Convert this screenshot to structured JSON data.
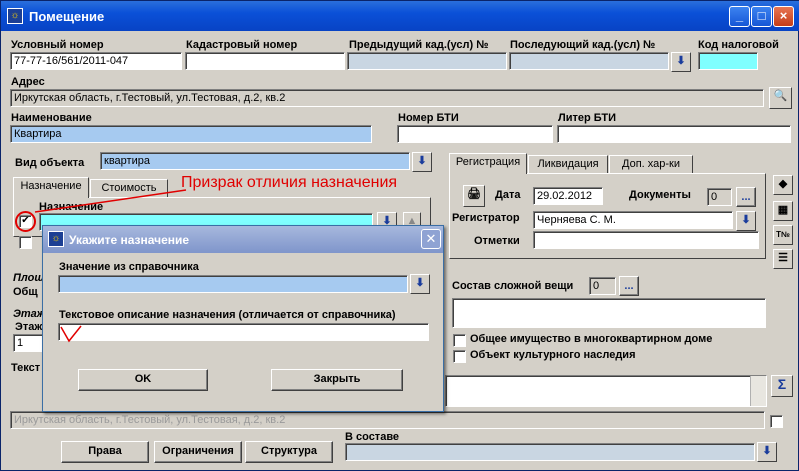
{
  "window": {
    "title": "Помещение",
    "icon": "app-icon",
    "min": "_",
    "max": "□",
    "close": "×"
  },
  "fields": {
    "cond_number": {
      "label": "Условный номер",
      "value": "77-77-16/561/2011-047"
    },
    "cadastral": {
      "label": "Кадастровый номер",
      "value": ""
    },
    "prev_cad": {
      "label": "Предыдущий кад.(усл) №",
      "value": ""
    },
    "last_cad": {
      "label": "Последующий кад.(усл) №",
      "value": ""
    },
    "tax_code": {
      "label": "Код налоговой",
      "value": ""
    },
    "address": {
      "label": "Адрес",
      "value": "Иркутская область, г.Тестовый, ул.Тестовая, д.2, кв.2"
    },
    "name": {
      "label": "Наименование",
      "value": "Квартира"
    },
    "bti_number": {
      "label": "Номер БТИ",
      "value": ""
    },
    "bti_letter": {
      "label": "Литер БТИ",
      "value": ""
    },
    "object_type": {
      "label": "Вид объекта",
      "value": "квартира"
    }
  },
  "left_tabs": [
    {
      "label": "Назначение",
      "active": true
    },
    {
      "label": "Стоимость",
      "active": false
    }
  ],
  "purpose": {
    "label": "Назначение",
    "checked": "✔"
  },
  "annotation": "Призрак отличия назначения",
  "right_tabs": [
    {
      "label": "Регистрация",
      "active": true
    },
    {
      "label": "Ликвидация",
      "active": false
    },
    {
      "label": "Доп. хар-ки",
      "active": false
    }
  ],
  "registration": {
    "date_label": "Дата",
    "date_value": "29.02.2012",
    "docs_label": "Документы",
    "docs_count": "0",
    "registrar_label": "Регистратор",
    "registrar_value": "Черняева С. М.",
    "notes_label": "Отметки",
    "notes_value": ""
  },
  "complex": {
    "label": "Состав сложной вещи",
    "count": "0"
  },
  "checkboxes": [
    {
      "label": "Общее имущество в многоквартирном доме"
    },
    {
      "label": "Объект культурного наследия"
    }
  ],
  "partial_labels": {
    "plosh": "Площ",
    "obsh": "Общ",
    "etazh": "Этаж",
    "etazh2": "Этаж",
    "floor_value": "1",
    "text": "Текст"
  },
  "address_bottom": "Иркутская область, г.Тестовый, ул.Тестовая, д.2, кв.2",
  "buttons": {
    "rights": "Права",
    "limits": "Ограничения",
    "structure": "Структура"
  },
  "in_composition": {
    "label": "В составе",
    "value": ""
  },
  "ellipsis": "...",
  "dropdown_glyph": "⬇",
  "dialog": {
    "title": "Укажите назначение",
    "dict_label": "Значение из справочника",
    "dict_value": "",
    "text_label": "Текстовое описание назначения (отличается от справочника)",
    "text_value": "",
    "ok": "OK",
    "close": "Закрыть"
  },
  "colors": {
    "cyan_field": "#7fffff",
    "blue_field": "#a6caf0",
    "title_active": "#0a50d8",
    "dialog_title": "#7f95cb",
    "annotation": "#e00000"
  }
}
